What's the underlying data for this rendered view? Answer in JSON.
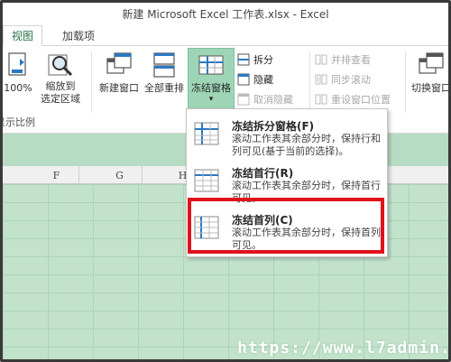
{
  "window": {
    "title": "新建 Microsoft Excel 工作表.xlsx - Excel"
  },
  "tabs": [
    {
      "label": "视图",
      "active": true
    },
    {
      "label": "加载项",
      "active": false
    }
  ],
  "ribbon": {
    "zoom_100": "100%",
    "zoom_to_selection_line1": "缩放到",
    "zoom_to_selection_line2": "选定区域",
    "new_window": "新建窗口",
    "arrange_all": "全部重排",
    "freeze_panes": "冻结窗格",
    "split": "拆分",
    "hide": "隐藏",
    "unhide": "取消隐藏",
    "view_side_by_side": "并排查看",
    "synchronous_scrolling": "同步滚动",
    "reset_window_position": "重设窗口位置",
    "switch_windows": "切换窗口",
    "group_zoom_label": "显示比例",
    "dropdown_arrow": "▾"
  },
  "colors": {
    "accent": "#217346",
    "freeze_button_bg": "#9fd5b7",
    "grid_green": "#c3e2cc",
    "highlight_red": "#e0121c"
  },
  "column_headers": [
    "F",
    "G",
    "H"
  ],
  "freeze_menu": {
    "items": [
      {
        "title": "冻结拆分窗格(F)",
        "desc": "滚动工作表其余部分时，保持行和列可见(基于当前的选择)。",
        "icon": "freeze-panes-icon"
      },
      {
        "title": "冻结首行(R)",
        "desc": "滚动工作表其余部分时，保持首行可见。",
        "icon": "freeze-top-row-icon"
      },
      {
        "title": "冻结首列(C)",
        "desc": "滚动工作表其余部分时，保持首列可见。",
        "icon": "freeze-first-column-icon"
      }
    ]
  },
  "watermark": "https://www.l7admin.cc"
}
